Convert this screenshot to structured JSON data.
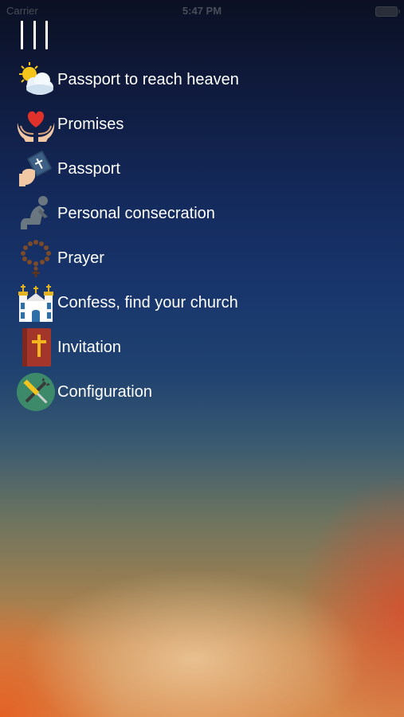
{
  "status_bar": {
    "carrier": "Carrier",
    "time": "5:47 PM"
  },
  "menu": {
    "items": [
      {
        "label": "Passport to reach heaven",
        "icon": "sun-cloud-icon"
      },
      {
        "label": "Promises",
        "icon": "heart-hands-icon"
      },
      {
        "label": "Passport",
        "icon": "hand-bible-icon"
      },
      {
        "label": "Personal consecration",
        "icon": "kneeling-person-icon"
      },
      {
        "label": "Prayer",
        "icon": "rosary-icon"
      },
      {
        "label": "Confess, find your church",
        "icon": "church-icon"
      },
      {
        "label": "Invitation",
        "icon": "bible-book-icon"
      },
      {
        "label": "Configuration",
        "icon": "tools-icon"
      }
    ]
  }
}
